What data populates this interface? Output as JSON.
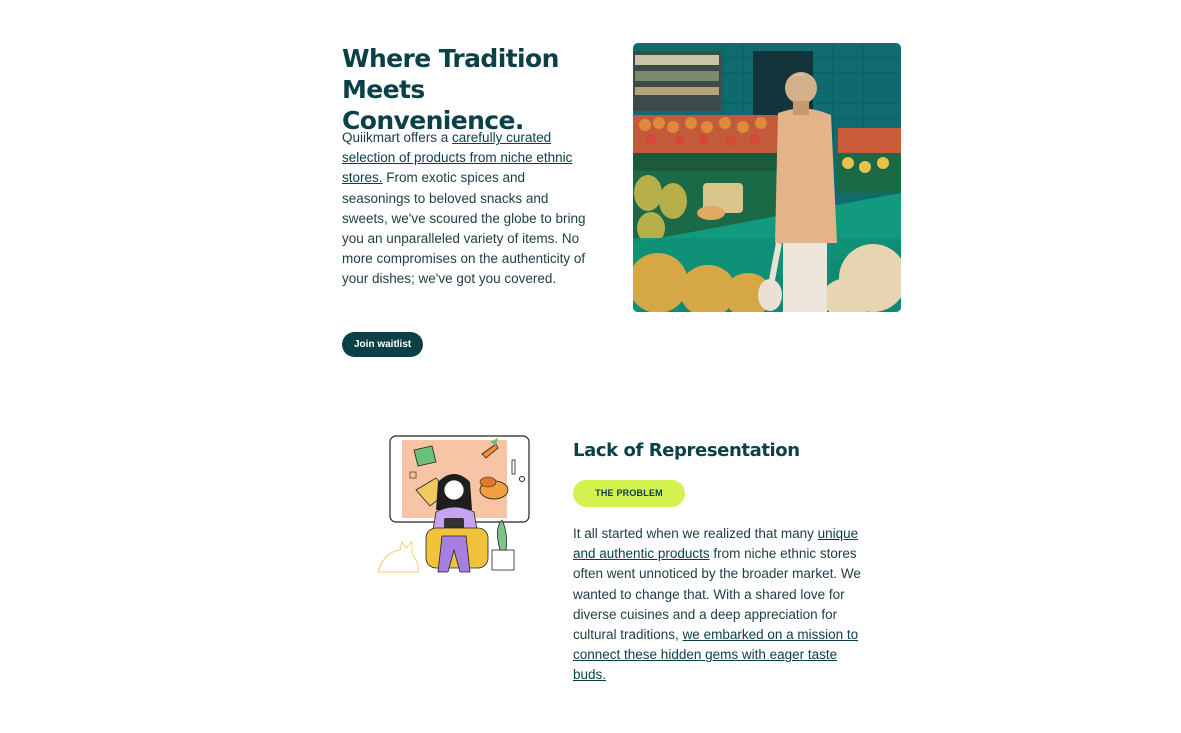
{
  "hero": {
    "title": "Where Tradition Meets Convenience.",
    "text_before": "Quiikmart offers a ",
    "text_link": "carefully curated selection of products from niche ethnic stores.",
    "text_after": " From exotic spices and seasonings to beloved snacks and sweets, we've scoured the globe to bring you an unparalleled variety of items. No more compromises on the authenticity of your dishes; we've got you covered.",
    "button_label": "Join waitlist"
  },
  "problem": {
    "title": "Lack of Representation",
    "badge": "THE PROBLEM",
    "text_before": "It all started when we realized that many ",
    "text_link1": "unique and authentic products",
    "text_middle": " from niche ethnic stores often went unnoticed by the broader market. We wanted to change that. With a shared love for diverse cuisines and a deep appreciation for cultural traditions, ",
    "text_link2": "we embarked on a mission to connect these hidden gems with eager taste buds."
  },
  "colors": {
    "brand_dark": "#0b4048",
    "badge_lime": "#d3f250",
    "text": "#1c3d44"
  }
}
